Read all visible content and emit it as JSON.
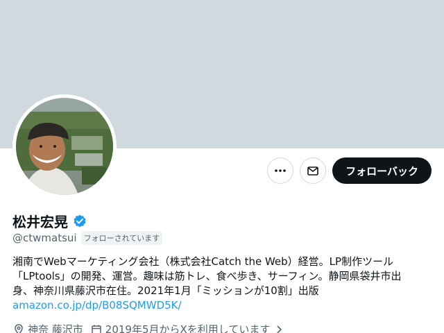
{
  "profile": {
    "display_name": "松井宏晃",
    "handle": "@ctwmatsui",
    "follows_you_label": "フォローされています",
    "bio_lines": [
      "湘南でWebマーケティング会社（株式会社Catch the Web）経営。LP制作ツール",
      "「LPtools」の開発、運営。趣味は筋トレ、食べ歩き、サーフィン。静岡県袋井市出",
      "身、神奈川県藤沢市在住。2021年1月「ミッションが10割」出版"
    ],
    "link": "amazon.co.jp/dp/B08SQMWD5K/",
    "location": "神奈 藤沢市",
    "joined": "2019年5月からXを利用しています"
  },
  "actions": {
    "more_icon": "more-icon",
    "message_icon": "mail-icon",
    "follow_back_label": "フォローバック"
  },
  "colors": {
    "banner": "#cfd9de",
    "verified": "#1d9bf0",
    "link": "#1d9bf0",
    "follow_button": "#0f1419"
  }
}
